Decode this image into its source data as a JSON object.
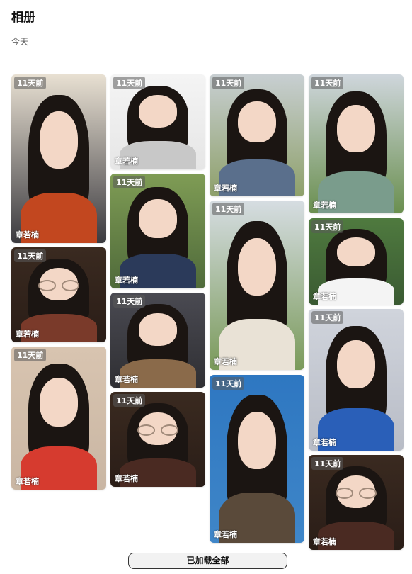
{
  "header": {
    "title": "相册",
    "section_date": "今天"
  },
  "photos": [
    {
      "badge": "11天前",
      "author": "章若楠",
      "bg": "#3b3a3f",
      "top_tint": "#e8e0d2",
      "outfit": "#c2471f",
      "glasses": false
    },
    {
      "badge": "11天前",
      "author": "章若楠",
      "bg": "#2a1d17",
      "top_tint": "#3a2a20",
      "outfit": "#7a3a2a",
      "glasses": true
    },
    {
      "badge": "11天前",
      "author": "章若楠",
      "bg": "#c9b6a3",
      "top_tint": "#d8c4b0",
      "outfit": "#d63b2f",
      "glasses": false
    },
    {
      "badge": "11天前",
      "author": "章若楠",
      "bg": "#e6e6e6",
      "top_tint": "#f4f4f4",
      "outfit": "#c8c8c8",
      "glasses": false
    },
    {
      "badge": "11天前",
      "author": "章若楠",
      "bg": "#4f6a3a",
      "top_tint": "#7f9c55",
      "outfit": "#2b3a5a",
      "glasses": false
    },
    {
      "badge": "11天前",
      "author": "章若楠",
      "bg": "#2f2f33",
      "top_tint": "#4a4a52",
      "outfit": "#8a6a4a",
      "glasses": false
    },
    {
      "badge": "11天前",
      "author": "章若楠",
      "bg": "#2a1d17",
      "top_tint": "#3a2a20",
      "outfit": "#4a2a22",
      "glasses": true
    },
    {
      "badge": "11天前",
      "author": "章若楠",
      "bg": "#8ea06a",
      "top_tint": "#c8cfd2",
      "outfit": "#5a6f8c",
      "glasses": false
    },
    {
      "badge": "11天前",
      "author": "章若楠",
      "bg": "#7a9a5a",
      "top_tint": "#d6dde2",
      "outfit": "#e9e2d6",
      "glasses": false
    },
    {
      "badge": "11天前",
      "author": "章若楠",
      "bg": "#3f86c8",
      "top_tint": "#2e77c1",
      "outfit": "#5a4a3a",
      "glasses": false
    },
    {
      "badge": "11天前",
      "author": "章若楠",
      "bg": "#6a8f4f",
      "top_tint": "#cfd6dc",
      "outfit": "#7a9c8c",
      "glasses": false
    },
    {
      "badge": "11天前",
      "author": "章若楠",
      "bg": "#3a5a32",
      "top_tint": "#4f7a3f",
      "outfit": "#f4f4f4",
      "glasses": false
    },
    {
      "badge": "11天前",
      "author": "章若楠",
      "bg": "#b8bcc6",
      "top_tint": "#d0d4dc",
      "outfit": "#2a5fb8",
      "glasses": false
    },
    {
      "badge": "11天前",
      "author": "章若楠",
      "bg": "#2a1d17",
      "top_tint": "#3a2a20",
      "outfit": "#4a2a22",
      "glasses": true
    }
  ],
  "footer": {
    "load_label": "已加载全部"
  }
}
